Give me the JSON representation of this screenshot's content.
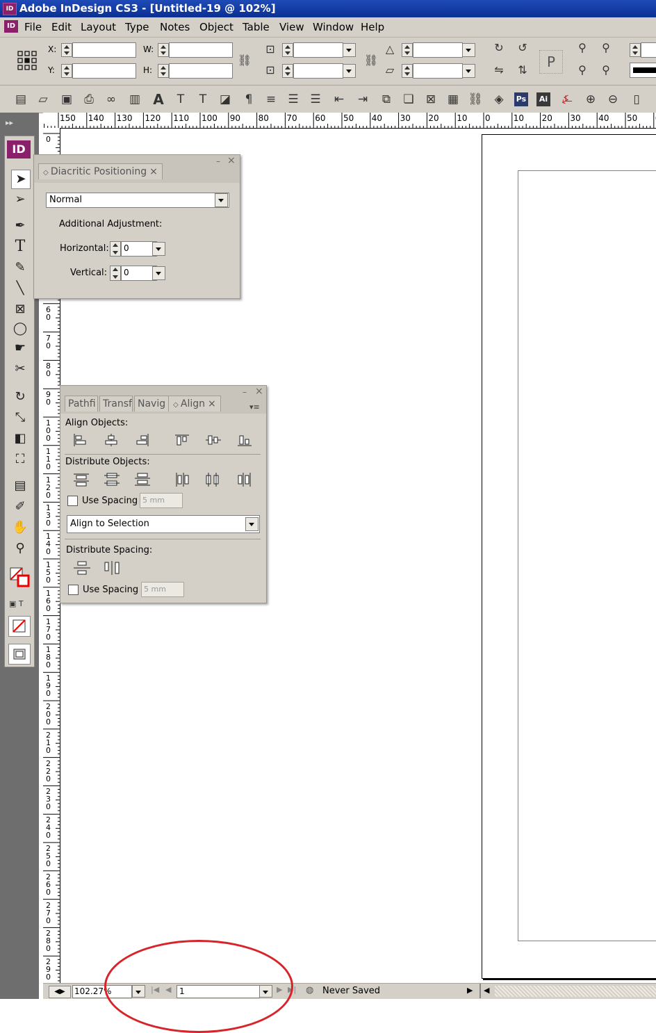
{
  "window": {
    "title": "Adobe InDesign CS3 - [Untitled-19 @ 102%]",
    "app_icon": "ID"
  },
  "menu": [
    "File",
    "Edit",
    "Layout",
    "Type",
    "Notes",
    "Object",
    "Table",
    "View",
    "Window",
    "Help"
  ],
  "control": {
    "x_label": "X:",
    "y_label": "Y:",
    "w_label": "W:",
    "h_label": "H:",
    "proxy_letter": "P"
  },
  "toolbar_labels": {
    "ps": "Ps",
    "ai": "Ai"
  },
  "hruler": [
    "150",
    "140",
    "130",
    "120",
    "110",
    "100",
    "90",
    "80",
    "70",
    "60",
    "50",
    "40",
    "30",
    "20",
    "10",
    "0",
    "10",
    "20",
    "30",
    "40",
    "50",
    "6"
  ],
  "vruler": [
    "0",
    "6 0",
    "7 0",
    "8 0",
    "9 0",
    "1 0 0",
    "1 1 0",
    "1 2 0",
    "1 3 0",
    "1 4 0",
    "1 5 0",
    "1 6 0",
    "1 7 0",
    "1 8 0",
    "1 9 0",
    "2 0 0",
    "2 1 0",
    "2 2 0",
    "2 3 0",
    "2 4 0",
    "2 5 0",
    "2 6 0",
    "2 7 0",
    "2 8 0",
    "2 9 0"
  ],
  "tools": {
    "logo": "ID"
  },
  "diacritic_panel": {
    "tab": "Diacritic Positioning",
    "mode": "Normal",
    "additional": "Additional Adjustment:",
    "horizontal_label": "Horizontal:",
    "horizontal_value": "0",
    "vertical_label": "Vertical:",
    "vertical_value": "0"
  },
  "align_panel": {
    "tabs": [
      "Pathfi",
      "Transf",
      "Navig",
      "Align"
    ],
    "align_objects": "Align Objects:",
    "distribute_objects": "Distribute Objects:",
    "use_spacing": "Use Spacing",
    "spacing_value": "5 mm",
    "align_to": "Align to Selection",
    "distribute_spacing": "Distribute Spacing:",
    "use_spacing2": "Use Spacing",
    "spacing_value2": "5 mm"
  },
  "status": {
    "zoom": "102.27%",
    "page": "1",
    "save_state": "Never Saved"
  },
  "colors": {
    "title_bar": "#0b2f93",
    "margin_guide": "#e040e0",
    "annotation": "#d8232a"
  }
}
